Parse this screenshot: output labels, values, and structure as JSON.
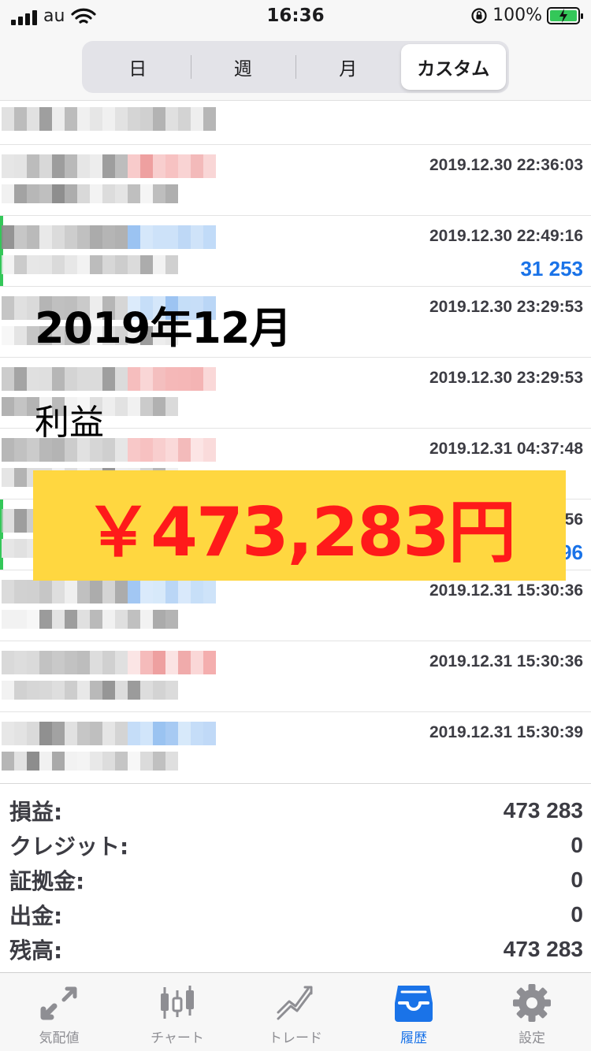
{
  "status_bar": {
    "carrier": "au",
    "time": "16:36",
    "battery": "100%"
  },
  "segments": [
    "日",
    "週",
    "月",
    "カスタム"
  ],
  "rows": [
    {
      "time": "",
      "profit": ""
    },
    {
      "time": "2019.12.30 22:36:03",
      "profit": ""
    },
    {
      "time": "2019.12.30 22:49:16",
      "profit": "31 253"
    },
    {
      "time": "2019.12.30 23:29:53",
      "profit": ""
    },
    {
      "time": "2019.12.30 23:29:53",
      "profit": ""
    },
    {
      "time": "2019.12.31 04:37:48",
      "profit": ""
    },
    {
      "time": "56",
      "profit": "96"
    },
    {
      "time": "2019.12.31 15:30:36",
      "profit": ""
    },
    {
      "time": "2019.12.31 15:30:36",
      "profit": ""
    },
    {
      "time": "2019.12.31 15:30:39",
      "profit": ""
    }
  ],
  "overlay": {
    "title": "2019年12月",
    "subtitle": "利益",
    "amount": "￥473,283円"
  },
  "summary": [
    {
      "label": "損益:",
      "value": "473 283"
    },
    {
      "label": "クレジット:",
      "value": "0"
    },
    {
      "label": "証拠金:",
      "value": "0"
    },
    {
      "label": "出金:",
      "value": "0"
    },
    {
      "label": "残高:",
      "value": "473 283"
    }
  ],
  "tabs": [
    {
      "label": "気配値",
      "icon": "quotes-arrows-icon"
    },
    {
      "label": "チャート",
      "icon": "candlestick-chart-icon"
    },
    {
      "label": "トレード",
      "icon": "trade-line-icon"
    },
    {
      "label": "履歴",
      "icon": "history-tray-icon"
    },
    {
      "label": "設定",
      "icon": "gear-icon"
    }
  ],
  "colors": {
    "accent_blue": "#1a73e8",
    "profit_green": "#34c759",
    "highlight_yellow": "#ffd740",
    "highlight_red": "#ff1a1a"
  }
}
